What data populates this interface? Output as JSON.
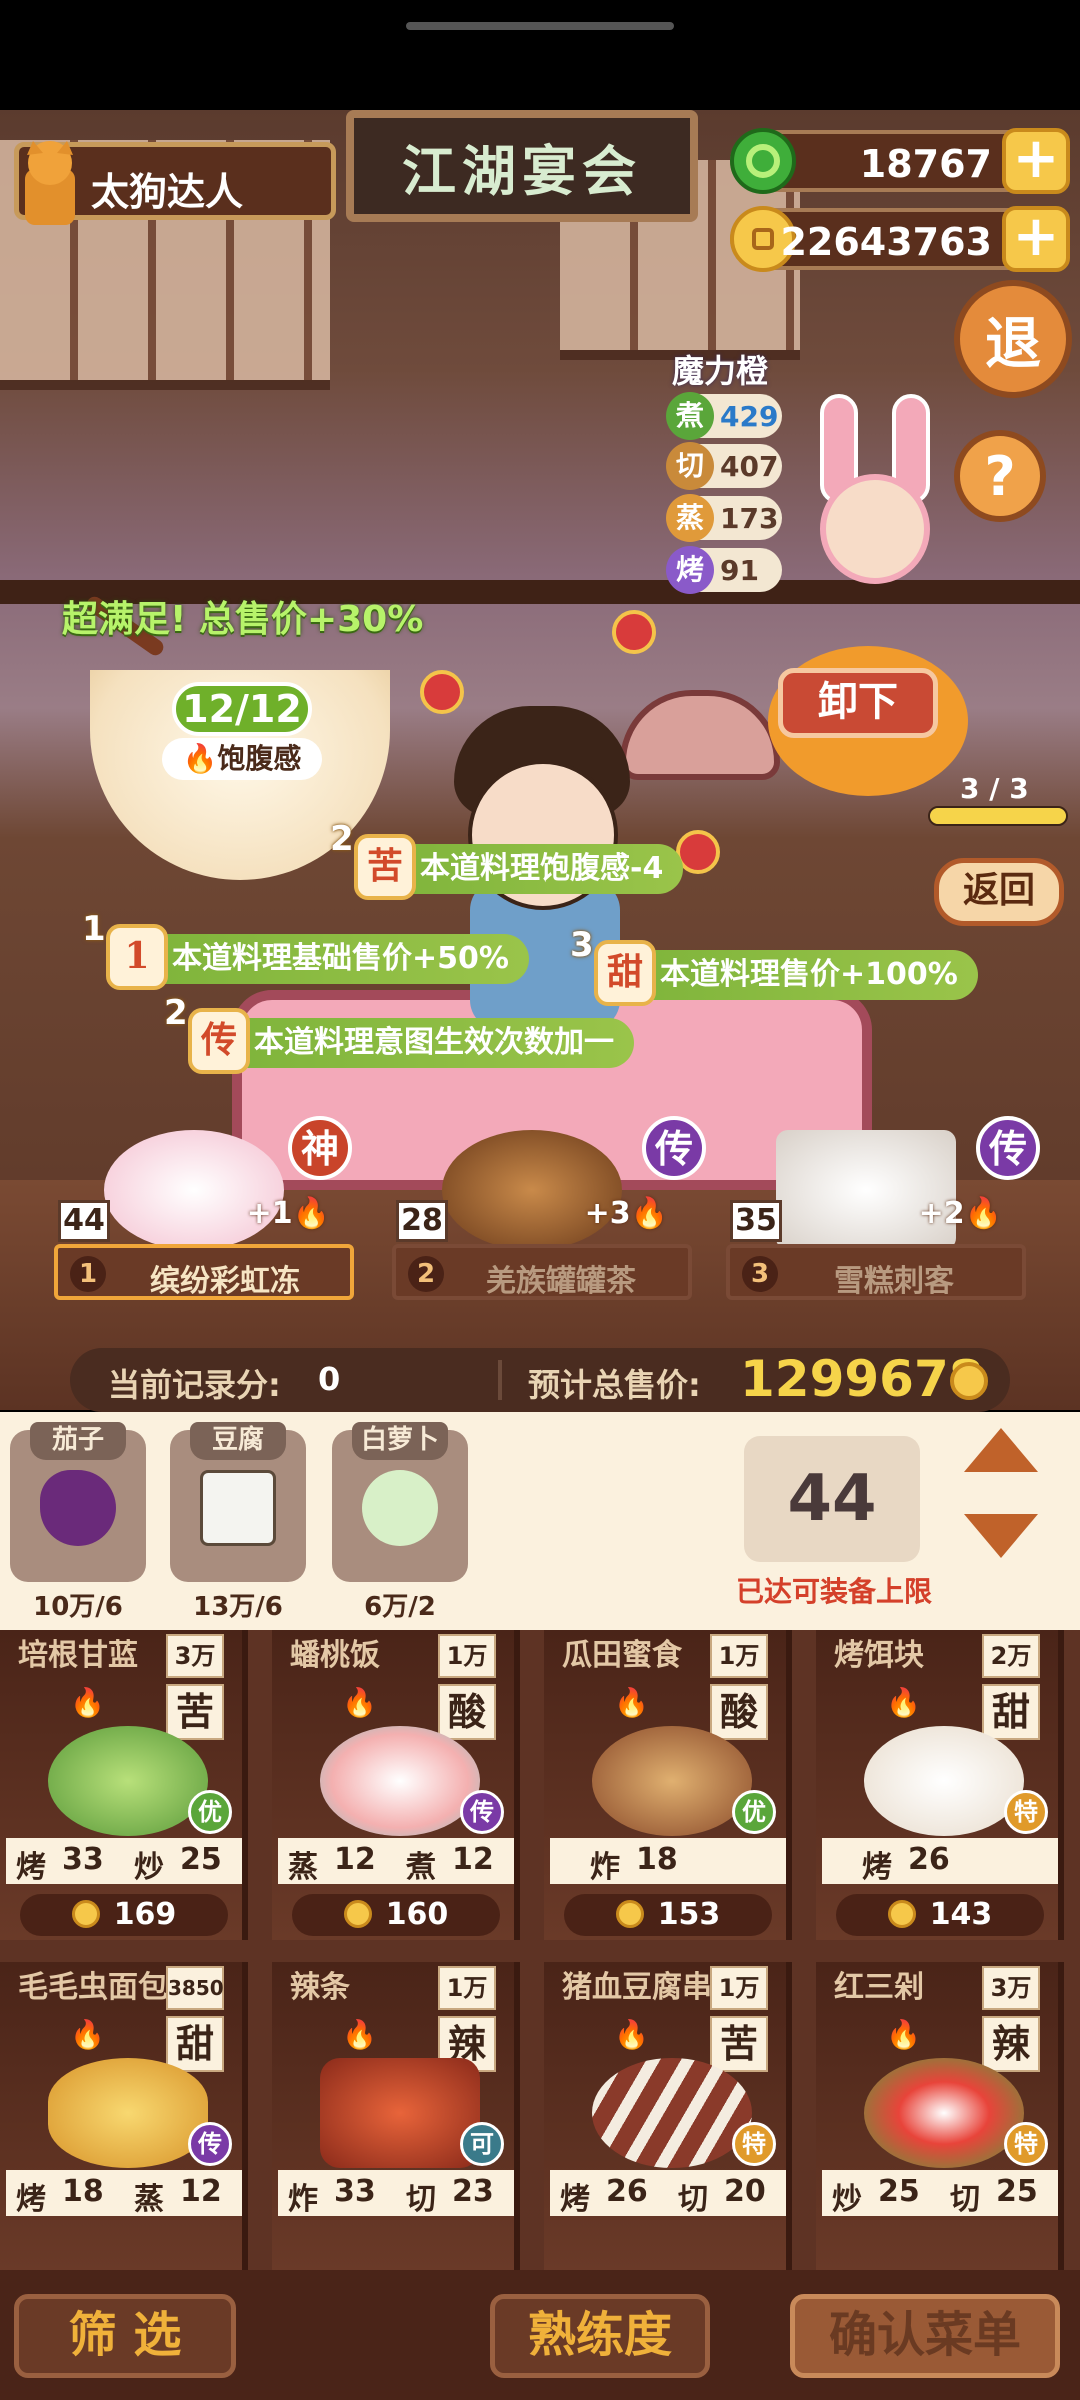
{
  "player": {
    "name": "太狗达人"
  },
  "title": "江湖宴会",
  "currency": {
    "jade": "18767",
    "coins": "22643763",
    "jade_color": "#3fae3a",
    "coin_color": "#f6c84a"
  },
  "buttons": {
    "exit": "退",
    "help": "?",
    "unload": "卸下",
    "back": "返回"
  },
  "npc": {
    "name": "魔力橙",
    "stats": [
      {
        "tag": "煮",
        "value": "429",
        "color": "#5aa63a"
      },
      {
        "tag": "切",
        "value": "407",
        "color": "#c98a3a"
      },
      {
        "tag": "蒸",
        "value": "173",
        "color": "#e09a3a"
      },
      {
        "tag": "烤",
        "value": "91",
        "color": "#8a5ac9"
      }
    ]
  },
  "bowl": {
    "bonus_text": "超满足!  总售价+30%",
    "fullness": "12/12",
    "fullness_label": "饱腹感"
  },
  "progress": {
    "label": "3 / 3",
    "fraction": 1.0
  },
  "buffs": [
    {
      "num": "2",
      "icon": "苦",
      "text": "本道料理饱腹感-4"
    },
    {
      "num": "1",
      "icon": "1",
      "text": "本道料理基础售价+50%"
    },
    {
      "num": "3",
      "icon": "甜",
      "text": "本道料理售价+100%"
    },
    {
      "num": "2",
      "icon": "传",
      "text": "本道料理意图生效次数加一"
    }
  ],
  "selected_dishes": [
    {
      "count": "44",
      "index": "1",
      "name": "缤纷彩虹冻",
      "bonus": "+1",
      "rarity": "神",
      "rarity_color": "#c9442a"
    },
    {
      "count": "28",
      "index": "2",
      "name": "羌族罐罐茶",
      "bonus": "+3",
      "rarity": "传",
      "rarity_color": "#7a3aa6"
    },
    {
      "count": "35",
      "index": "3",
      "name": "雪糕刺客",
      "bonus": "+2",
      "rarity": "传",
      "rarity_color": "#7a3aa6"
    }
  ],
  "score": {
    "record_label": "当前记录分:",
    "record_value": "0",
    "total_label": "预计总售价:",
    "total_value": "1299678"
  },
  "ingredients": [
    {
      "label": "茄子",
      "count": "10万/6",
      "color": "#6a2a7a"
    },
    {
      "label": "豆腐",
      "count": "13万/6",
      "color": "#f4f4f0"
    },
    {
      "label": "白萝卜",
      "count": "6万/2",
      "color": "#d8f0c8"
    }
  ],
  "capacity": {
    "value": "44",
    "warning": "已达可装备上限"
  },
  "recipes": [
    {
      "name": "培根甘蓝",
      "price": "3万",
      "flavor": "苦",
      "grade": "优",
      "grade_color": "#5aa63a",
      "skills": [
        [
          "烤",
          "33"
        ],
        [
          "炒",
          "25"
        ]
      ],
      "cost": "169",
      "food_color": "#8ac45a"
    },
    {
      "name": "蟠桃饭",
      "price": "1万",
      "flavor": "酸",
      "grade": "传",
      "grade_color": "#7a3aa6",
      "skills": [
        [
          "蒸",
          "12"
        ],
        [
          "煮",
          "12"
        ]
      ],
      "cost": "160",
      "food_color": "#f4d0d0"
    },
    {
      "name": "瓜田蜜食",
      "price": "1万",
      "flavor": "酸",
      "grade": "优",
      "grade_color": "#5aa63a",
      "skills": [
        [
          "炸",
          "18"
        ]
      ],
      "cost": "153",
      "food_color": "#c98a4a"
    },
    {
      "name": "烤饵块",
      "price": "2万",
      "flavor": "甜",
      "grade": "特",
      "grade_color": "#e09a2a",
      "skills": [
        [
          "烤",
          "26"
        ]
      ],
      "cost": "143",
      "food_color": "#f4ece0"
    },
    {
      "name": "毛毛虫面包",
      "price": "3850",
      "flavor": "甜",
      "grade": "传",
      "grade_color": "#7a3aa6",
      "skills": [
        [
          "烤",
          "18"
        ],
        [
          "蒸",
          "12"
        ]
      ],
      "cost": "",
      "food_color": "#f0b84a"
    },
    {
      "name": "辣条",
      "price": "1万",
      "flavor": "辣",
      "grade": "可",
      "grade_color": "#3a7a8a",
      "skills": [
        [
          "炸",
          "33"
        ],
        [
          "切",
          "23"
        ]
      ],
      "cost": "",
      "food_color": "#c9442a"
    },
    {
      "name": "猪血豆腐串",
      "price": "1万",
      "flavor": "苦",
      "grade": "特",
      "grade_color": "#e09a2a",
      "skills": [
        [
          "烤",
          "26"
        ],
        [
          "切",
          "20"
        ]
      ],
      "cost": "",
      "food_color": "#8a3a2a"
    },
    {
      "name": "红三剁",
      "price": "3万",
      "flavor": "辣",
      "grade": "特",
      "grade_color": "#e09a2a",
      "skills": [
        [
          "炒",
          "25"
        ],
        [
          "切",
          "25"
        ]
      ],
      "cost": "",
      "food_color": "#d8442a"
    }
  ],
  "bottom": {
    "filter": "筛  选",
    "proficiency": "熟练度",
    "confirm": "确认菜单"
  }
}
